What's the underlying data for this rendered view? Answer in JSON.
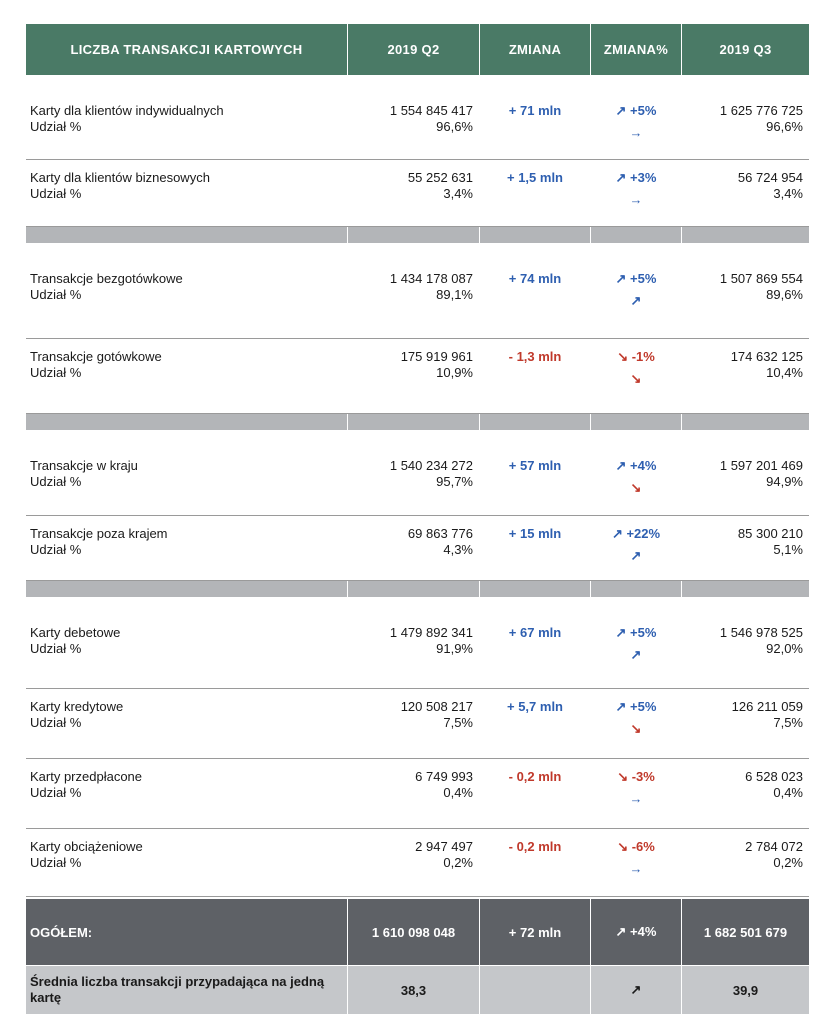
{
  "header": {
    "col1": "LICZBA TRANSAKCJI KARTOWYCH",
    "col2": "2019  Q2",
    "col3": "ZMIANA",
    "col4": "ZMIANA%",
    "col5": "2019  Q3"
  },
  "share_label": "Udział %",
  "groups": [
    [
      {
        "label": "Karty dla klientów indywidualnych",
        "q2": "1 554 845 417",
        "q2_share": "96,6%",
        "change": "+ 71 mln",
        "change_dir": "up",
        "pct": "↗ +5%",
        "pct_dir": "up",
        "trend": "→",
        "trend_dir": "up",
        "q3": "1 625 776 725",
        "q3_share": "96,6%"
      },
      {
        "label": "Karty dla klientów biznesowych",
        "q2": "55 252 631",
        "q2_share": "3,4%",
        "change": "+ 1,5 mln",
        "change_dir": "up",
        "pct": "↗ +3%",
        "pct_dir": "up",
        "trend": "→",
        "trend_dir": "up",
        "q3": "56 724 954",
        "q3_share": "3,4%"
      }
    ],
    [
      {
        "label": "Transakcje bezgotówkowe",
        "q2": "1 434 178 087",
        "q2_share": "89,1%",
        "change": "+ 74 mln",
        "change_dir": "up",
        "pct": "↗ +5%",
        "pct_dir": "up",
        "trend": "↗",
        "trend_dir": "up",
        "q3": "1 507 869 554",
        "q3_share": "89,6%"
      },
      {
        "label": "Transakcje gotówkowe",
        "q2": "175 919 961",
        "q2_share": "10,9%",
        "change": "- 1,3 mln",
        "change_dir": "down",
        "pct": "↘ -1%",
        "pct_dir": "down",
        "trend": "↘",
        "trend_dir": "down",
        "q3": "174 632 125",
        "q3_share": "10,4%"
      }
    ],
    [
      {
        "label": "Transakcje w kraju",
        "q2": "1 540 234 272",
        "q2_share": "95,7%",
        "change": "+ 57 mln",
        "change_dir": "up",
        "pct": "↗ +4%",
        "pct_dir": "up",
        "trend": "↘",
        "trend_dir": "down",
        "q3": "1 597 201 469",
        "q3_share": "94,9%"
      },
      {
        "label": "Transakcje poza krajem",
        "q2": "69 863 776",
        "q2_share": "4,3%",
        "change": "+ 15 mln",
        "change_dir": "up",
        "pct": "↗ +22%",
        "pct_dir": "up",
        "trend": "↗",
        "trend_dir": "up",
        "q3": "85 300 210",
        "q3_share": "5,1%"
      }
    ],
    [
      {
        "label": "Karty debetowe",
        "q2": "1 479 892 341",
        "q2_share": "91,9%",
        "change": "+ 67 mln",
        "change_dir": "up",
        "pct": "↗ +5%",
        "pct_dir": "up",
        "trend": "↗",
        "trend_dir": "up",
        "q3": "1 546 978 525",
        "q3_share": "92,0%"
      },
      {
        "label": "Karty kredytowe",
        "q2": "120 508 217",
        "q2_share": "7,5%",
        "change": "+ 5,7 mln",
        "change_dir": "up",
        "pct": "↗ +5%",
        "pct_dir": "up",
        "trend": "↘",
        "trend_dir": "down",
        "q3": "126 211 059",
        "q3_share": "7,5%"
      },
      {
        "label": "Karty przedpłacone",
        "q2": "6 749 993",
        "q2_share": "0,4%",
        "change": "- 0,2 mln",
        "change_dir": "down",
        "pct": "↘ -3%",
        "pct_dir": "down",
        "trend": "→",
        "trend_dir": "up",
        "q3": "6 528 023",
        "q3_share": "0,4%"
      },
      {
        "label": "Karty obciążeniowe",
        "q2": "2 947 497",
        "q2_share": "0,2%",
        "change": "- 0,2 mln",
        "change_dir": "down",
        "pct": "↘ -6%",
        "pct_dir": "down",
        "trend": "→",
        "trend_dir": "up",
        "q3": "2 784 072",
        "q3_share": "0,2%"
      }
    ]
  ],
  "total": {
    "label": "OGÓŁEM:",
    "q2": "1 610 098 048",
    "change": "+ 72 mln",
    "pct": "↗ +4%",
    "q3": "1 682 501 679"
  },
  "average": {
    "label": "Średnia liczba transakcji przypadająca na jedną kartę",
    "q2": "38,3",
    "trend": "↗",
    "q3": "39,9"
  },
  "colors": {
    "header_bg": "#4a7a66",
    "up": "#2e5fb0",
    "down": "#c0392b",
    "total_bg": "#5e6166",
    "separator_bg": "#b3b5b8",
    "average_bg": "#c5c7ca"
  }
}
